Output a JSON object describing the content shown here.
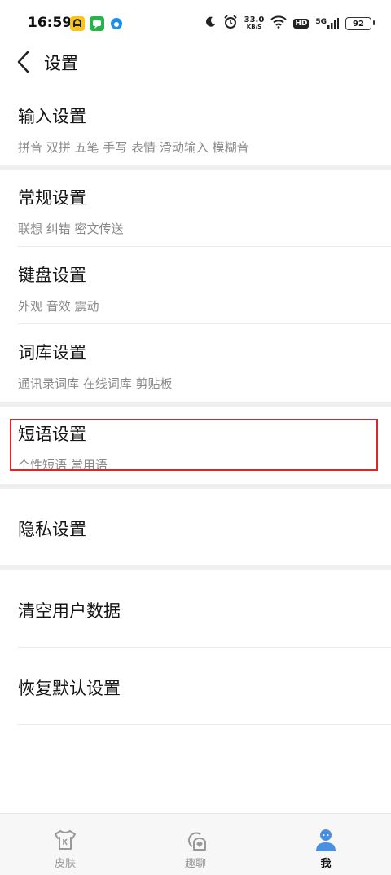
{
  "status_bar": {
    "time": "16:59",
    "speed_value": "33.0",
    "speed_unit": "KB/S",
    "hd_label": "HD",
    "network": "5G",
    "battery": "92"
  },
  "header": {
    "title": "设置"
  },
  "sections": {
    "input": {
      "title": "输入设置",
      "subtitle": "拼音 双拼 五笔 手写 表情 滑动输入 模糊音"
    },
    "general": {
      "title": "常规设置",
      "subtitle": "联想 纠错 密文传送"
    },
    "keyboard": {
      "title": "键盘设置",
      "subtitle": "外观 音效 震动"
    },
    "dictionary": {
      "title": "词库设置",
      "subtitle": "通讯录词库 在线词库 剪贴板"
    },
    "phrases": {
      "title": "短语设置",
      "subtitle": "个性短语 常用语"
    },
    "privacy": {
      "title": "隐私设置"
    },
    "clear_data": {
      "title": "清空用户数据"
    },
    "restore": {
      "title": "恢复默认设置"
    }
  },
  "bottom_nav": {
    "skin": "皮肤",
    "chat": "趣聊",
    "me": "我"
  },
  "colors": {
    "highlight": "#e0242b",
    "accent_blue": "#4a90e2"
  }
}
